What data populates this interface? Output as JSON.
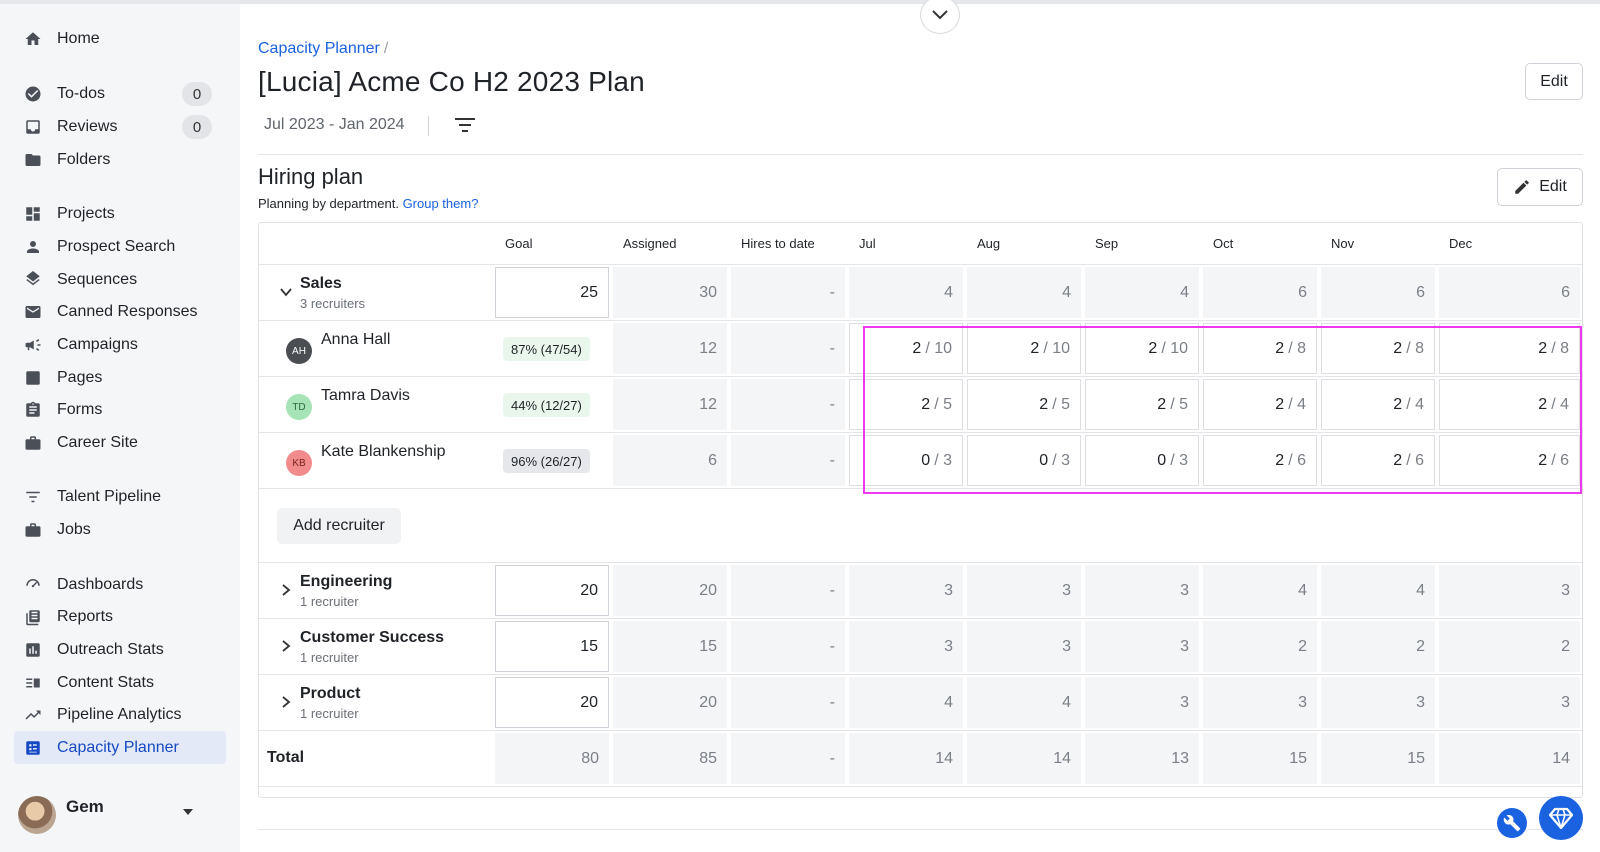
{
  "sidebar": {
    "items": [
      {
        "label": "Home",
        "icon": "home-icon"
      },
      {
        "label": "To-dos",
        "icon": "check-circle-icon",
        "badge": "0"
      },
      {
        "label": "Reviews",
        "icon": "inbox-icon",
        "badge": "0"
      },
      {
        "label": "Folders",
        "icon": "folder-icon"
      },
      {
        "label": "Projects",
        "icon": "grid-icon"
      },
      {
        "label": "Prospect Search",
        "icon": "person-icon"
      },
      {
        "label": "Sequences",
        "icon": "layers-icon"
      },
      {
        "label": "Canned Responses",
        "icon": "mail-icon"
      },
      {
        "label": "Campaigns",
        "icon": "megaphone-icon"
      },
      {
        "label": "Pages",
        "icon": "page-icon"
      },
      {
        "label": "Forms",
        "icon": "clipboard-icon"
      },
      {
        "label": "Career Site",
        "icon": "briefcase-icon"
      },
      {
        "label": "Talent Pipeline",
        "icon": "filter-icon"
      },
      {
        "label": "Jobs",
        "icon": "briefcase-icon"
      },
      {
        "label": "Dashboards",
        "icon": "gauge-icon"
      },
      {
        "label": "Reports",
        "icon": "report-icon"
      },
      {
        "label": "Outreach Stats",
        "icon": "bar-chart-icon"
      },
      {
        "label": "Content Stats",
        "icon": "content-stats-icon"
      },
      {
        "label": "Pipeline Analytics",
        "icon": "trend-icon"
      },
      {
        "label": "Capacity Planner",
        "icon": "planner-icon",
        "active": true
      }
    ],
    "user": {
      "name": "Gem"
    }
  },
  "breadcrumb": {
    "root": "Capacity Planner",
    "sep": "/"
  },
  "page": {
    "title": "[Lucia] Acme Co H2 2023 Plan",
    "edit_label": "Edit",
    "date_range": "Jul 2023 - Jan 2024"
  },
  "hiring_plan": {
    "title": "Hiring plan",
    "subtitle": "Planning by department.",
    "group_link": "Group them?",
    "edit_label": "Edit",
    "columns": [
      "Goal",
      "Assigned",
      "Hires to date",
      "Jul",
      "Aug",
      "Sep",
      "Oct",
      "Nov",
      "Dec"
    ],
    "sales": {
      "name": "Sales",
      "sub": "3 recruiters",
      "goal": "25",
      "assigned": "30",
      "hires": "-",
      "months": [
        "4",
        "4",
        "4",
        "6",
        "6",
        "6"
      ]
    },
    "recruiters": [
      {
        "initials": "AH",
        "name": "Anna Hall",
        "pct": "87% (47/54)",
        "pill_color": "#e9f6ec",
        "avatar_bg": "#4a4d52",
        "avatar_fg": "#ffffff",
        "assigned": "12",
        "hires": "-",
        "alloc": [
          [
            "2",
            "/ 10"
          ],
          [
            "2",
            "/ 10"
          ],
          [
            "2",
            "/ 10"
          ],
          [
            "2",
            "/ 8"
          ],
          [
            "2",
            "/ 8"
          ],
          [
            "2",
            "/ 8"
          ]
        ]
      },
      {
        "initials": "TD",
        "name": "Tamra Davis",
        "pct": "44% (12/27)",
        "pill_color": "#e9f6ec",
        "avatar_bg": "#a6e3b6",
        "avatar_fg": "#2c6b3d",
        "assigned": "12",
        "hires": "-",
        "alloc": [
          [
            "2",
            "/ 5"
          ],
          [
            "2",
            "/ 5"
          ],
          [
            "2",
            "/ 5"
          ],
          [
            "2",
            "/ 4"
          ],
          [
            "2",
            "/ 4"
          ],
          [
            "2",
            "/ 4"
          ]
        ]
      },
      {
        "initials": "KB",
        "name": "Kate Blankenship",
        "pct": "96% (26/27)",
        "pill_color": "#e5e7eb",
        "avatar_bg": "#f28b8b",
        "avatar_fg": "#7a1f1f",
        "assigned": "6",
        "hires": "-",
        "alloc": [
          [
            "0",
            "/ 3"
          ],
          [
            "0",
            "/ 3"
          ],
          [
            "0",
            "/ 3"
          ],
          [
            "2",
            "/ 6"
          ],
          [
            "2",
            "/ 6"
          ],
          [
            "2",
            "/ 6"
          ]
        ]
      }
    ],
    "add_recruiter": "Add recruiter",
    "departments": [
      {
        "name": "Engineering",
        "sub": "1 recruiter",
        "goal": "20",
        "assigned": "20",
        "hires": "-",
        "months": [
          "3",
          "3",
          "3",
          "4",
          "4",
          "3"
        ]
      },
      {
        "name": "Customer Success",
        "sub": "1 recruiter",
        "goal": "15",
        "assigned": "15",
        "hires": "-",
        "months": [
          "3",
          "3",
          "3",
          "2",
          "2",
          "2"
        ]
      },
      {
        "name": "Product",
        "sub": "1 recruiter",
        "goal": "20",
        "assigned": "20",
        "hires": "-",
        "months": [
          "4",
          "4",
          "3",
          "3",
          "3",
          "3"
        ]
      }
    ],
    "total": {
      "label": "Total",
      "goal": "80",
      "assigned": "85",
      "hires": "-",
      "months": [
        "14",
        "14",
        "13",
        "15",
        "15",
        "14"
      ]
    }
  }
}
